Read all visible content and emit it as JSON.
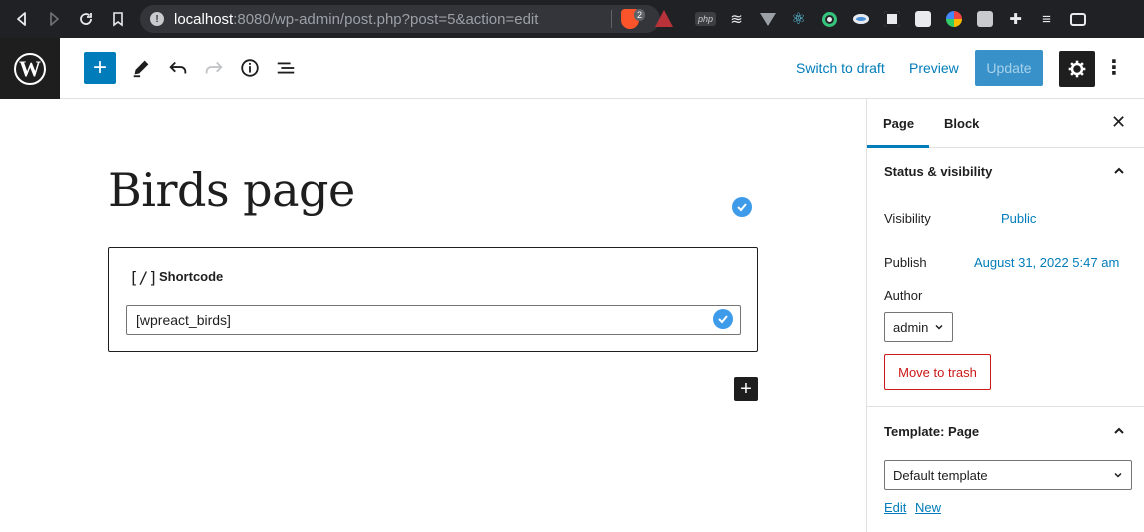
{
  "browser": {
    "url_host": "localhost",
    "url_rest": ":8080/wp-admin/post.php?post=5&action=edit",
    "shield_count": "2",
    "extensions": [
      "php-icon",
      "wave-icon",
      "vue-icon",
      "react-icon",
      "target-icon",
      "eye-icon",
      "qr-icon",
      "trello-icon",
      "color-icon",
      "notes-icon",
      "puzzle-icon",
      "playlist-icon",
      "wallet-icon"
    ]
  },
  "toolbar": {
    "switch_to_draft": "Switch to draft",
    "preview": "Preview",
    "update": "Update"
  },
  "editor": {
    "title": "Birds page",
    "block_name": "Shortcode",
    "block_icon": "[/]",
    "shortcode_value": "[wpreact_birds]"
  },
  "sidebar": {
    "tabs": [
      "Page",
      "Block"
    ],
    "status_visibility": {
      "title": "Status & visibility",
      "visibility_label": "Visibility",
      "visibility_value": "Public",
      "publish_label": "Publish",
      "publish_value": "August 31, 2022 5:47 am",
      "author_label": "Author",
      "author_value": "admin",
      "trash_label": "Move to trash"
    },
    "template": {
      "title": "Template: Page",
      "selected": "Default template",
      "edit_link": "Edit",
      "new_link": "New"
    }
  },
  "colors": {
    "wp_blue": "#007cba",
    "danger": "#cc1818",
    "dark": "#1e1e1e",
    "check_blue": "#3d9be9"
  }
}
